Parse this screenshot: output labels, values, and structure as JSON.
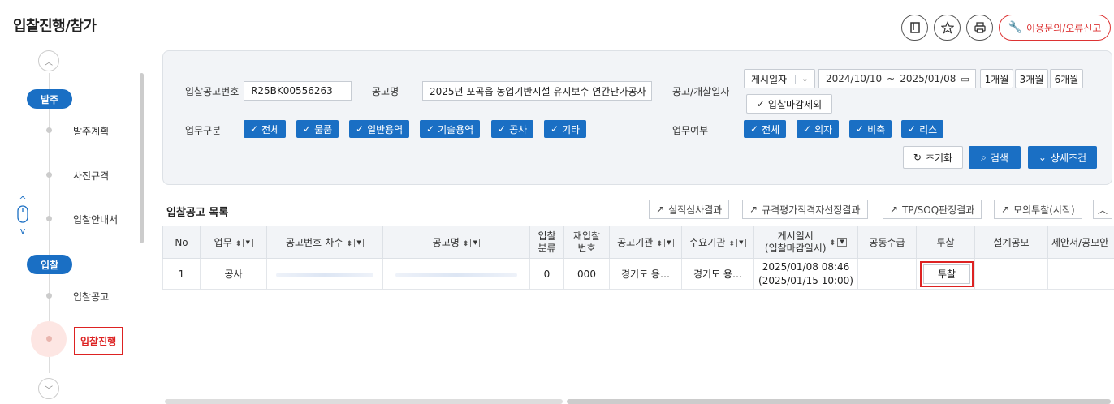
{
  "page_title": "입찰진행/참가",
  "report_label": "이용문의/오류신고",
  "sidebar": {
    "stage1": "발주",
    "items1": [
      "발주계획",
      "사전규격",
      "입찰안내서"
    ],
    "stage2": "입찰",
    "items2": [
      "입찰공고"
    ],
    "active": "입찰진행"
  },
  "search": {
    "bid_no_label": "입찰공고번호",
    "bid_no_value": "R25BK00556263",
    "name_label": "공고명",
    "name_value": "2025년 포곡읍 농업기반시설 유지보수 연간단가공사",
    "date_label": "공고/개찰일자",
    "date_type": "게시일자",
    "date_from": "2024/10/10",
    "date_sep": "~",
    "date_to": "2025/01/08",
    "range_1m": "1개월",
    "range_3m": "3개월",
    "range_6m": "6개월",
    "exclude_closed": "입찰마감제외",
    "biz_type_label": "업무구분",
    "biz_types": [
      "전체",
      "물품",
      "일반용역",
      "기술용역",
      "공사",
      "기타"
    ],
    "biz_flag_label": "업무여부",
    "biz_flags": [
      "전체",
      "외자",
      "비축",
      "리스"
    ],
    "reset_label": "초기화",
    "search_label": "검색",
    "detail_label": "상세조건"
  },
  "list": {
    "title": "입찰공고 목록",
    "buttons": [
      "실적심사결과",
      "규격평가적격자선정결과",
      "TP/SOQ판정결과",
      "모의투찰(시작)"
    ],
    "columns": [
      "No",
      "업무",
      "공고번호-차수",
      "공고명",
      "입찰\n분류",
      "재입찰\n번호",
      "공고기관",
      "수요기관",
      "게시일시\n(입찰마감일시)",
      "공동수급",
      "투찰",
      "설계공모",
      "제안서/공모안"
    ],
    "rows": [
      {
        "no": "1",
        "biz": "공사",
        "bid_no": "",
        "name": "",
        "bid_class": "0",
        "rebid": "000",
        "agency": "경기도 용…",
        "demand": "경기도 용…",
        "posted": "2025/01/08 08:46",
        "deadline": "(2025/01/15 10:00)",
        "joint": "",
        "bid_btn": "투찰",
        "design": "",
        "proposal": ""
      }
    ]
  },
  "colors": {
    "accent": "#1a6fc4",
    "alert": "#d22222"
  }
}
